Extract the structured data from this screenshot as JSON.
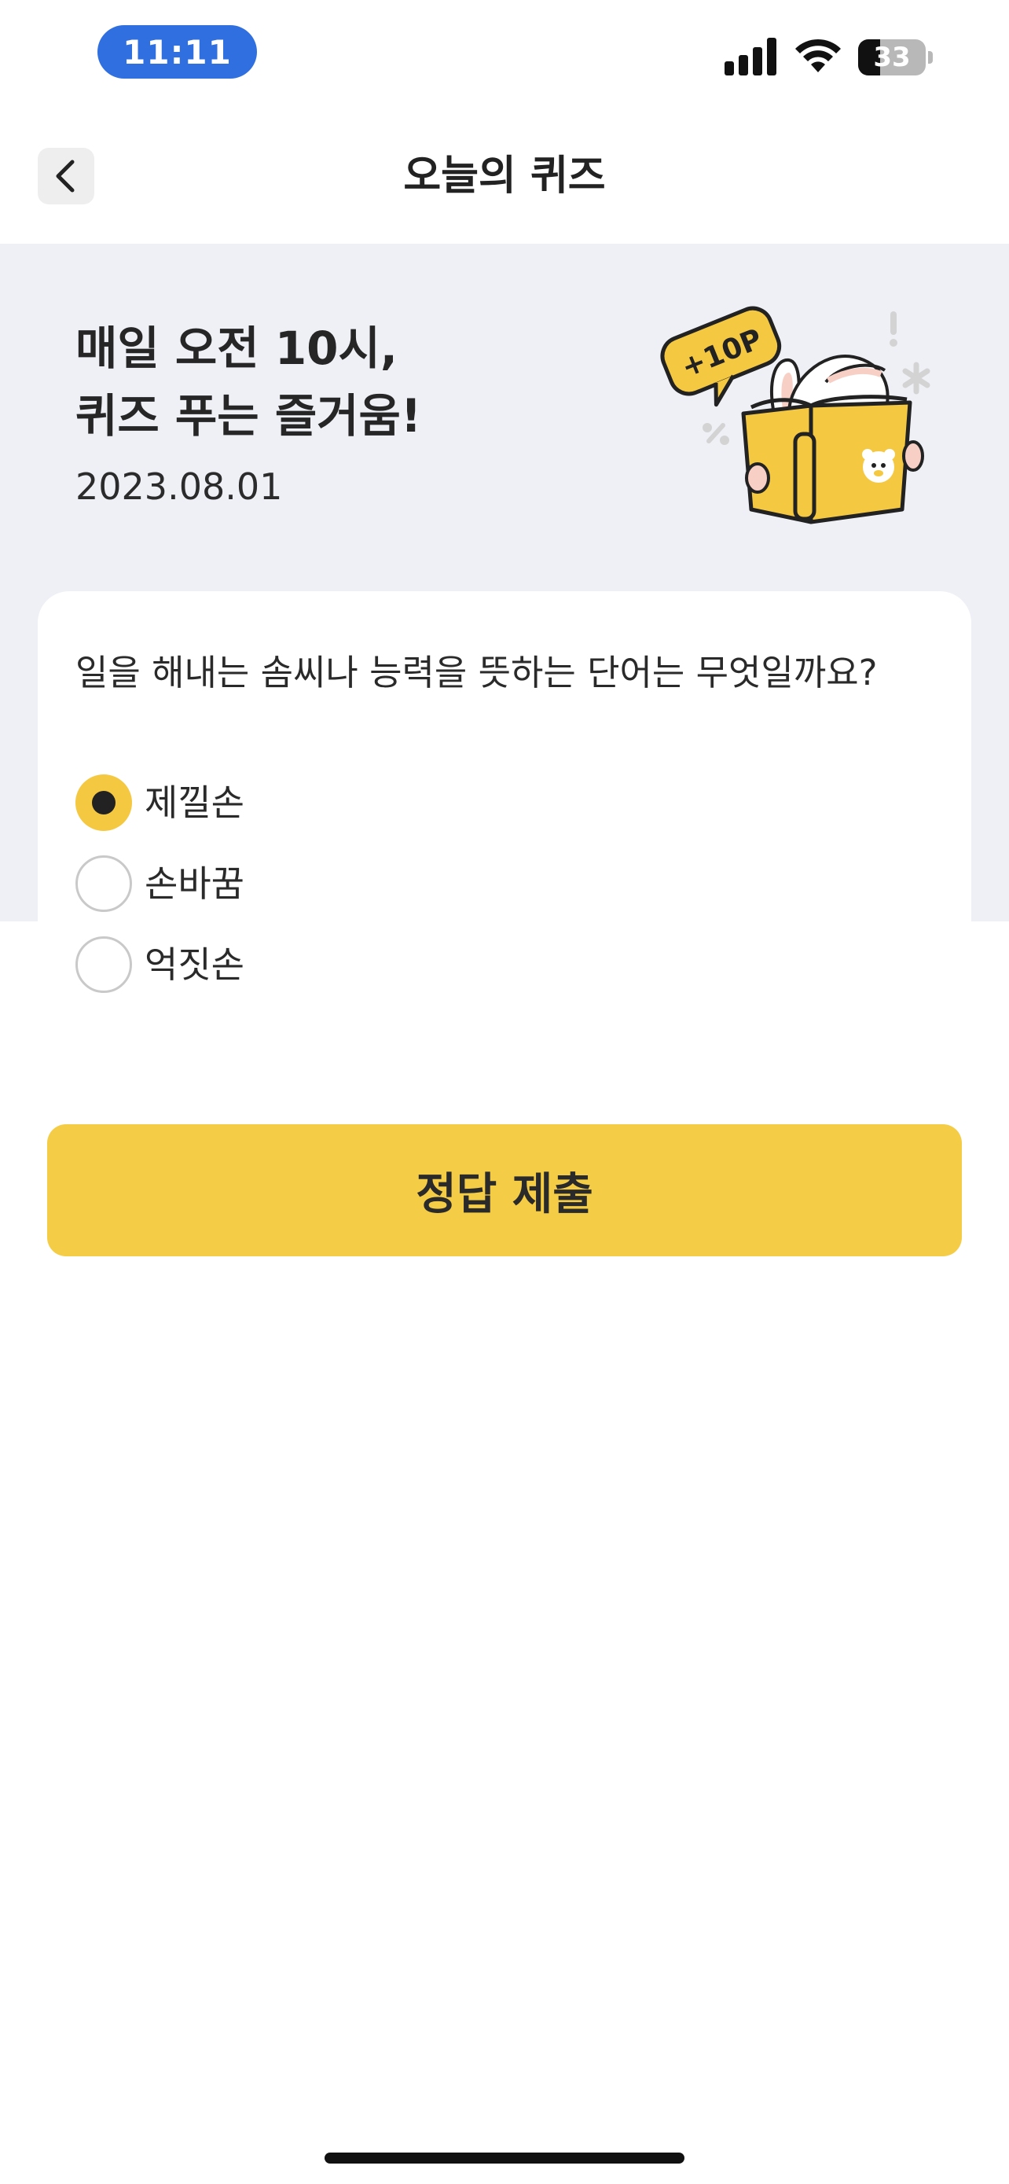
{
  "status_bar": {
    "time": "11:11",
    "battery_level": "33",
    "battery_fraction": 0.33,
    "icons": [
      "signal-bars-icon",
      "wifi-icon",
      "battery-icon"
    ]
  },
  "header": {
    "title": "오늘의 퀴즈",
    "back_icon": "chevron-left-icon"
  },
  "hero": {
    "title_line1": "매일 오전 10시,",
    "title_line2": "퀴즈 푸는 즐거움!",
    "date": "2023.08.01",
    "badge": "+10P",
    "badge_color": "#F5C842"
  },
  "quiz": {
    "question": "일을 해내는 솜씨나 능력을 뜻하는 단어는 무엇일까요?",
    "options": [
      {
        "label": "제낄손",
        "selected": true
      },
      {
        "label": "손바꿈",
        "selected": false
      },
      {
        "label": "억짓손",
        "selected": false
      }
    ],
    "submit_label": "정답 제출"
  },
  "colors": {
    "accent": "#F5CC45",
    "hero_background": "#EFF0F5",
    "time_pill": "#2F6FE0"
  }
}
